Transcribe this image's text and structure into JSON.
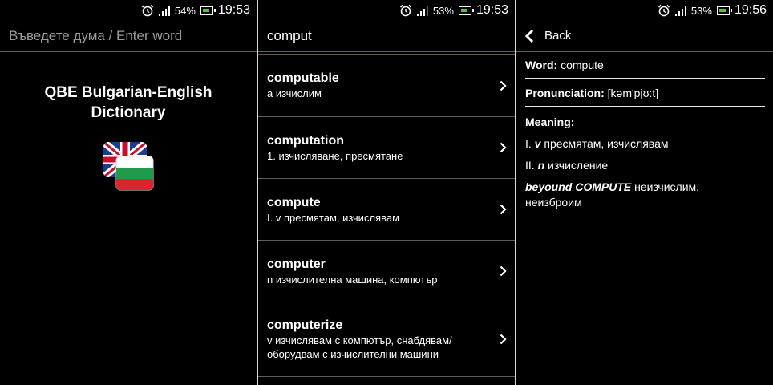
{
  "status_bars": [
    {
      "battery": "54%",
      "time": "19:53"
    },
    {
      "battery": "53%",
      "time": "19:53"
    },
    {
      "battery": "53%",
      "time": "19:56"
    }
  ],
  "home": {
    "search_placeholder": "Въведете дума / Enter word",
    "app_title_line1": "QBE Bulgarian-English",
    "app_title_line2": "Dictionary"
  },
  "results": {
    "query": "comput",
    "items": [
      {
        "word": "computable",
        "translation": "a изчислим"
      },
      {
        "word": "computation",
        "translation": "1. изчисляване, пресмятане"
      },
      {
        "word": "compute",
        "translation": "I. v пресмятам, изчислявам"
      },
      {
        "word": "computer",
        "translation": "n изчислителна машина, компютър"
      },
      {
        "word": "computerize",
        "translation_line1": "v изчислявам с компютър, снабдявам/",
        "translation_line2": "оборудвам с изчислителни машини"
      }
    ]
  },
  "detail": {
    "back_label": "Back",
    "word_label": "Word:",
    "word": "compute",
    "pron_label": "Pronunciation:",
    "pronunciation": "[kəm'pjʊ:t]",
    "meaning_label": "Meaning:",
    "meaning1_num": "I.",
    "meaning1_pos": "v",
    "meaning1_text": "пресмятам, изчислявам",
    "meaning2_num": "II.",
    "meaning2_pos": "n",
    "meaning2_text": "изчисление",
    "phrase": "beyound COMPUTE",
    "phrase_text_line1": "неизчислим,",
    "phrase_text_line2": "неизброим"
  },
  "colors": {
    "background": "#000000",
    "accent_line": "#2d6d89",
    "battery_fill": "#5ac13a",
    "separator": "#5a5a5a"
  },
  "icons": [
    "alarm-clock-icon",
    "signal-icon",
    "battery-icon",
    "chevron-right-icon",
    "back-arrow-icon",
    "uk-bulgaria-flag-logo"
  ]
}
